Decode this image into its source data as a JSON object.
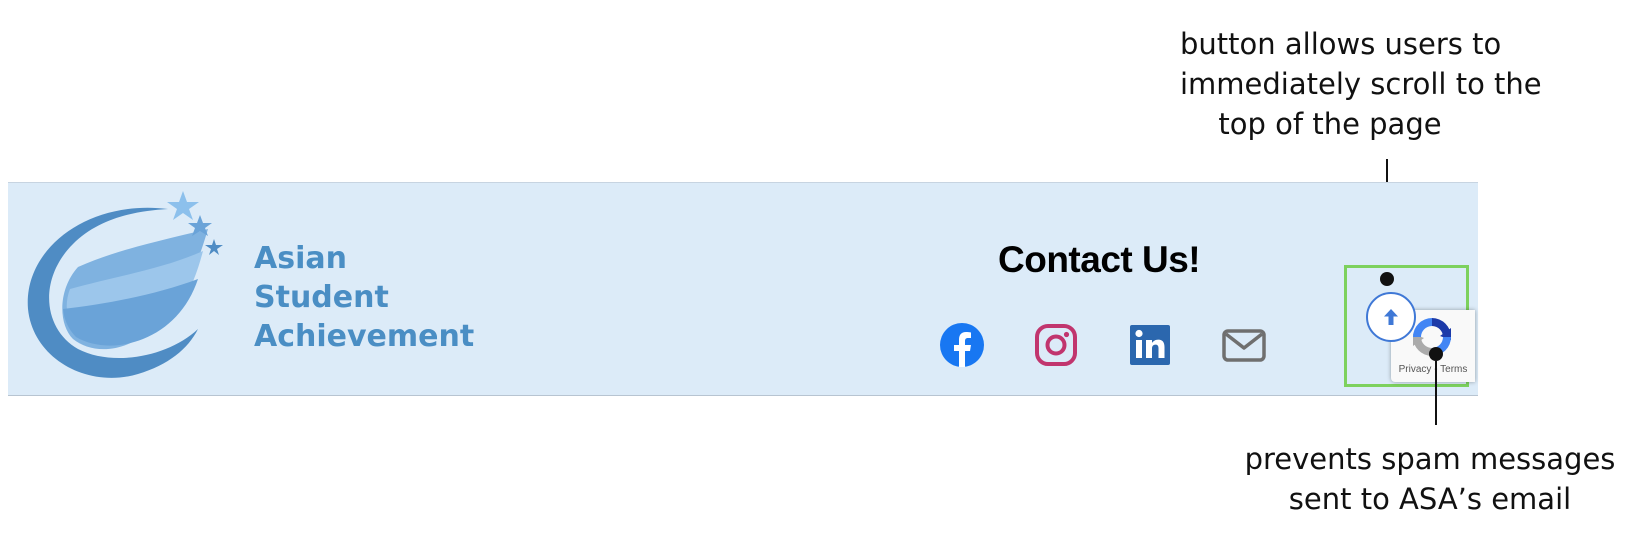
{
  "annotations": {
    "top": {
      "lines": [
        "button allows users to",
        "immediately scroll to the",
        "top of the page"
      ]
    },
    "bottom": {
      "lines": [
        "prevents spam messages",
        "sent to ASA’s email"
      ]
    }
  },
  "footer": {
    "logo": {
      "lines": [
        "Asian",
        "Student",
        "Achievement"
      ]
    },
    "contact": {
      "title": "Contact Us!"
    },
    "social_icons": [
      "facebook-icon",
      "instagram-icon",
      "linkedin-icon",
      "mail-icon"
    ],
    "back_to_top_icon": "arrow-up-icon",
    "recaptcha": {
      "privacy": "Privacy",
      "separator": " - ",
      "terms": "Terms"
    }
  },
  "colors": {
    "footer_bg": "#dcebf8",
    "logo_text": "#4a8ec4",
    "facebook": "#1877f2",
    "instagram": "#c1356e",
    "linkedin": "#2b67ae",
    "mail": "#6f6f6f",
    "highlight": "#7dd15e",
    "back_to_top": "#3f78d6"
  }
}
